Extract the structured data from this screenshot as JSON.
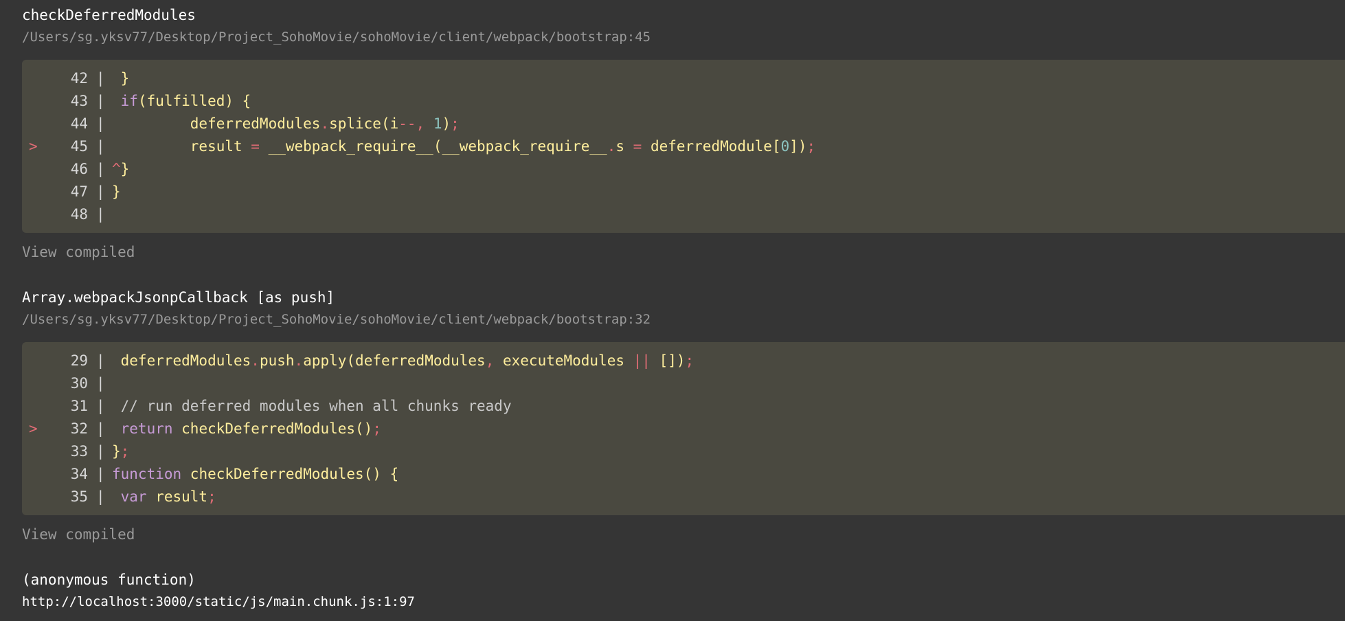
{
  "frames": [
    {
      "function_name": "checkDeferredModules",
      "file": "/Users/sg.yksv77/Desktop/Project_SohoMovie/sohoMovie/client/webpack/bootstrap:45",
      "view_compiled_label": "View compiled",
      "lines": [
        {
          "marker": "",
          "number": "42",
          "sep": "|",
          "tokens": [
            {
              "t": "id",
              "v": " }"
            }
          ]
        },
        {
          "marker": "",
          "number": "43",
          "sep": "|",
          "tokens": [
            {
              "t": "kw",
              "v": " if"
            },
            {
              "t": "id",
              "v": "(fulfilled) {"
            }
          ]
        },
        {
          "marker": "",
          "number": "44",
          "sep": "|",
          "tokens": [
            {
              "t": "id",
              "v": "         deferredModules"
            },
            {
              "t": "op",
              "v": "."
            },
            {
              "t": "id",
              "v": "splice(i"
            },
            {
              "t": "op",
              "v": "--"
            },
            {
              "t": "op",
              "v": ","
            },
            {
              "t": "id",
              "v": " "
            },
            {
              "t": "num",
              "v": "1"
            },
            {
              "t": "id",
              "v": ")"
            },
            {
              "t": "op",
              "v": ";"
            }
          ]
        },
        {
          "marker": ">",
          "number": "45",
          "sep": "|",
          "tokens": [
            {
              "t": "id",
              "v": "         result "
            },
            {
              "t": "op",
              "v": "="
            },
            {
              "t": "id",
              "v": " __webpack_require__(__webpack_require__"
            },
            {
              "t": "op",
              "v": "."
            },
            {
              "t": "id",
              "v": "s "
            },
            {
              "t": "op",
              "v": "="
            },
            {
              "t": "id",
              "v": " deferredModule["
            },
            {
              "t": "num",
              "v": "0"
            },
            {
              "t": "id",
              "v": "])"
            },
            {
              "t": "op",
              "v": ";"
            }
          ]
        },
        {
          "marker": "",
          "number": "46",
          "sep": "|",
          "tokens": [
            {
              "t": "op",
              "v": "^"
            },
            {
              "t": "id",
              "v": "}"
            }
          ]
        },
        {
          "marker": "",
          "number": "47",
          "sep": "|",
          "tokens": [
            {
              "t": "id",
              "v": "}"
            }
          ]
        },
        {
          "marker": "",
          "number": "48",
          "sep": "|",
          "tokens": []
        }
      ]
    },
    {
      "function_name": "Array.webpackJsonpCallback [as push]",
      "file": "/Users/sg.yksv77/Desktop/Project_SohoMovie/sohoMovie/client/webpack/bootstrap:32",
      "view_compiled_label": "View compiled",
      "lines": [
        {
          "marker": "",
          "number": "29",
          "sep": "|",
          "tokens": [
            {
              "t": "id",
              "v": " deferredModules"
            },
            {
              "t": "op",
              "v": "."
            },
            {
              "t": "id",
              "v": "push"
            },
            {
              "t": "op",
              "v": "."
            },
            {
              "t": "id",
              "v": "apply(deferredModules"
            },
            {
              "t": "op",
              "v": ","
            },
            {
              "t": "id",
              "v": " executeModules "
            },
            {
              "t": "op",
              "v": "||"
            },
            {
              "t": "id",
              "v": " [])"
            },
            {
              "t": "op",
              "v": ";"
            }
          ]
        },
        {
          "marker": "",
          "number": "30",
          "sep": "|",
          "tokens": []
        },
        {
          "marker": "",
          "number": "31",
          "sep": "|",
          "tokens": [
            {
              "t": "cm",
              "v": " // run deferred modules when all chunks ready"
            }
          ]
        },
        {
          "marker": ">",
          "number": "32",
          "sep": "|",
          "tokens": [
            {
              "t": "kw",
              "v": " return"
            },
            {
              "t": "id",
              "v": " checkDeferredModules()"
            },
            {
              "t": "op",
              "v": ";"
            }
          ]
        },
        {
          "marker": "",
          "number": "33",
          "sep": "|",
          "tokens": [
            {
              "t": "id",
              "v": "}"
            },
            {
              "t": "op",
              "v": ";"
            }
          ]
        },
        {
          "marker": "",
          "number": "34",
          "sep": "|",
          "tokens": [
            {
              "t": "kw",
              "v": "function"
            },
            {
              "t": "id",
              "v": " checkDeferredModules() {"
            }
          ]
        },
        {
          "marker": "",
          "number": "35",
          "sep": "|",
          "tokens": [
            {
              "t": "kw",
              "v": " var"
            },
            {
              "t": "id",
              "v": " result"
            },
            {
              "t": "op",
              "v": ";"
            }
          ]
        }
      ]
    }
  ],
  "last_frame": {
    "function_name": "(anonymous function)",
    "url": "http://localhost:3000/static/js/main.chunk.js:1:97"
  },
  "colors": {
    "background": "#353535",
    "code_background": "#4a4940",
    "identifier": "#ffee9d",
    "keyword": "#c79bd6",
    "operator": "#e06c75",
    "number": "#8cc4c0",
    "muted": "#9a9a9a"
  }
}
